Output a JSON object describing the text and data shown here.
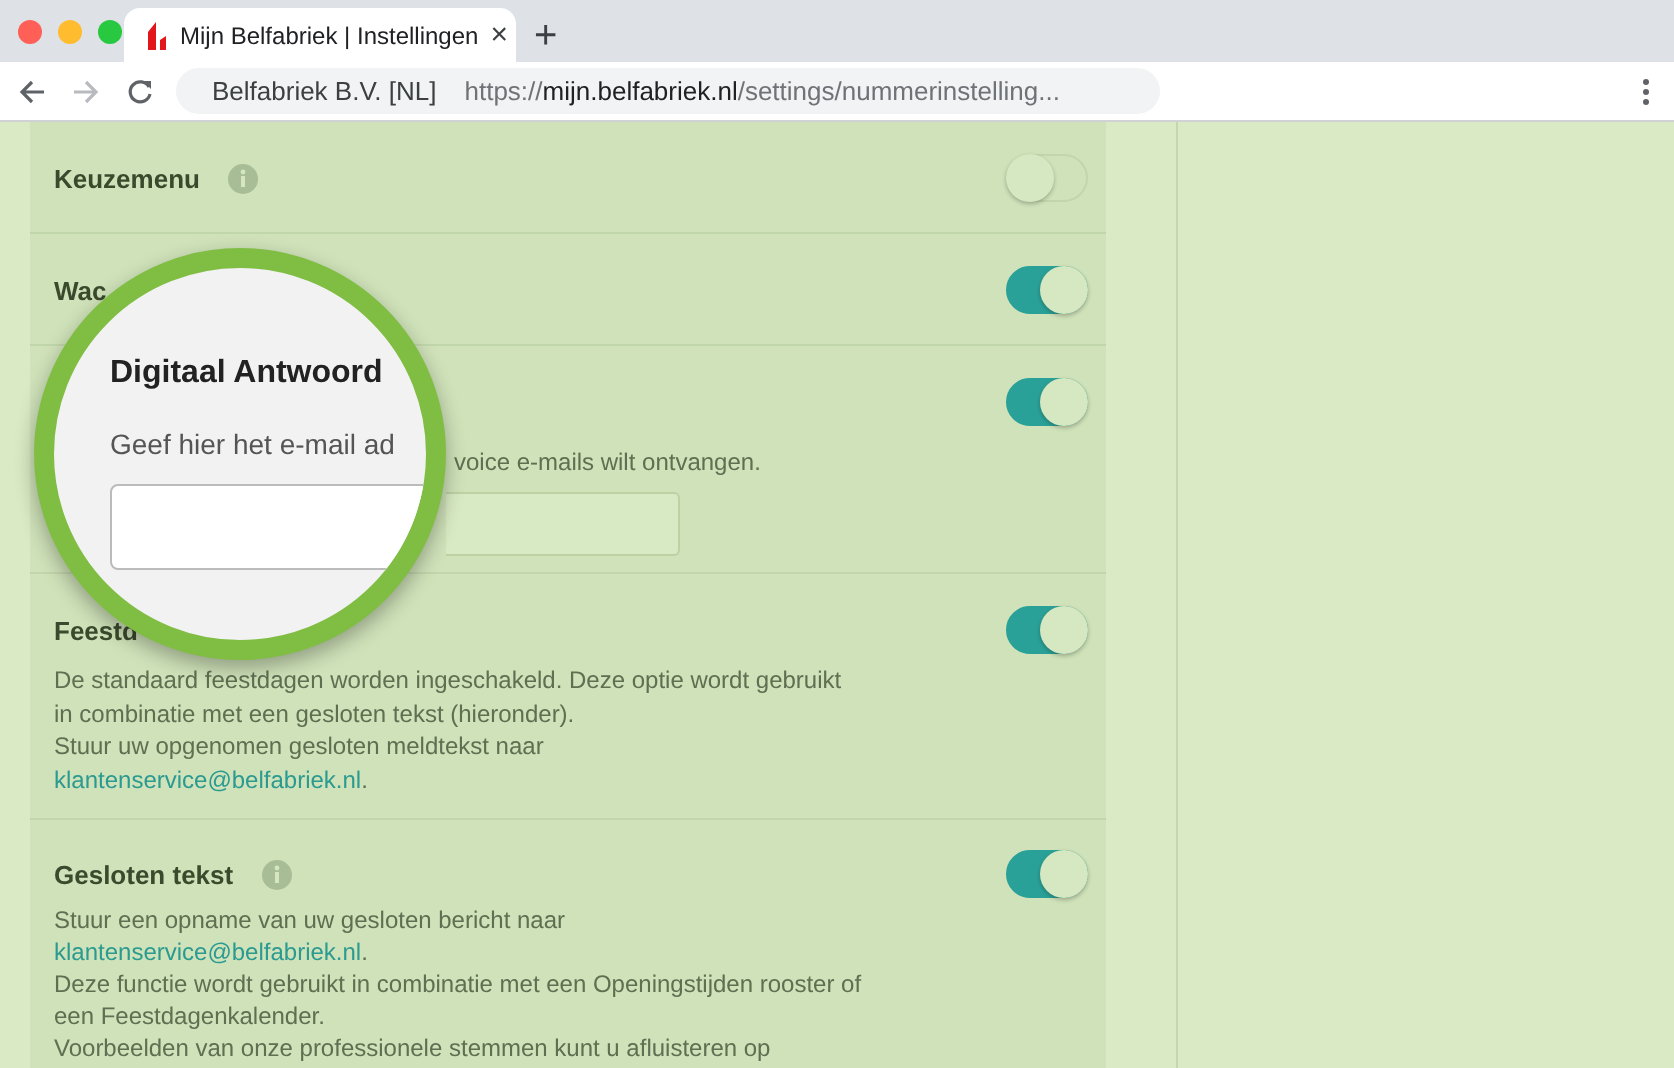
{
  "browser": {
    "tab": {
      "title": "Mijn Belfabriek | Instellingen",
      "close": "×"
    },
    "new_tab": "+",
    "site_name": "Belfabriek B.V. [NL]",
    "url": {
      "scheme": "https://",
      "host": "mijn.belfabriek.nl",
      "path": "/settings/nummerinstelling..."
    }
  },
  "settings": [
    {
      "title": "Keuzemenu",
      "info": true,
      "on": false
    },
    {
      "title": "Wac",
      "on": true
    },
    {
      "on": true,
      "covered_text": "voice e-mails wilt ontvangen.",
      "field": true
    },
    {
      "title": "Feestd",
      "on": true,
      "paragraphs": [
        {
          "parts": [
            {
              "kind": "text",
              "text": "De standaard feestdagen worden ingeschakeld. Deze optie wordt gebruikt in combinatie met een gesloten tekst (hieronder)."
            }
          ]
        },
        {
          "parts": [
            {
              "kind": "text",
              "text": "Stuur uw opgenomen gesloten meldtekst naar "
            },
            {
              "kind": "link",
              "text": "klantenservice@belfabriek.nl"
            },
            {
              "kind": "text",
              "text": "."
            }
          ]
        }
      ]
    },
    {
      "title": "Gesloten tekst",
      "info": true,
      "on": true,
      "paragraphs": [
        {
          "parts": [
            {
              "kind": "text",
              "text": "Stuur een opname van uw gesloten bericht naar "
            },
            {
              "kind": "link",
              "text": "klantenservice@belfabriek.nl"
            },
            {
              "kind": "text",
              "text": "."
            }
          ]
        },
        {
          "parts": [
            {
              "kind": "text",
              "text": "Deze functie wordt gebruikt in combinatie met een Openingstijden rooster of een Feestdagenkalender."
            }
          ]
        },
        {
          "parts": [
            {
              "kind": "text",
              "text": "Voorbeelden van onze professionele stemmen kunt u afluisteren op"
            }
          ]
        }
      ]
    }
  ],
  "magnifier": {
    "heading": "Digitaal Antwoord",
    "text": "Geef hier het e-mail ad",
    "field": true
  }
}
